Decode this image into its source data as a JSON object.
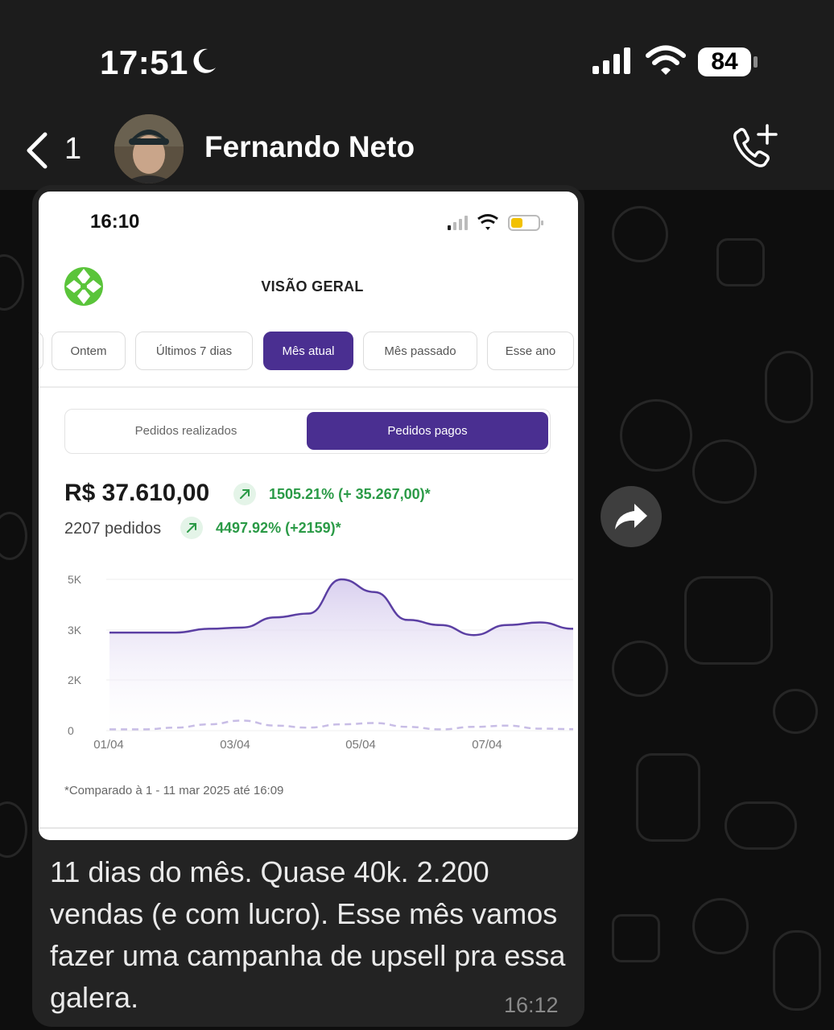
{
  "status_bar": {
    "time": "17:51",
    "battery": "84"
  },
  "header": {
    "back_count": "1",
    "contact_name": "Fernando Neto"
  },
  "message": {
    "text": "11 dias do mês. Quase 40k. 2.200 vendas (e com lucro). Esse mês vamos fazer uma campanha de upsell pra essa galera.",
    "time": "16:12"
  },
  "screenshot": {
    "time": "16:10",
    "title": "VISÃO GERAL",
    "tabs": [
      "Ontem",
      "Últimos 7 dias",
      "Mês atual",
      "Mês passado",
      "Esse ano"
    ],
    "active_tab": "Mês atual",
    "segments": {
      "left": "Pedidos realizados",
      "right": "Pedidos pagos",
      "active": "Pedidos pagos"
    },
    "amount": "R$ 37.610,00",
    "amount_change": "1505.21% (+ 35.267,00)*",
    "orders": "2207 pedidos",
    "orders_change": "4497.92% (+2159)*",
    "footnote": "*Comparado à 1 - 11 mar 2025 até 16:09"
  },
  "chart_data": {
    "type": "area",
    "x_ticks": [
      "01/04",
      "03/04",
      "05/04",
      "07/04"
    ],
    "y_ticks": [
      "5K",
      "3K",
      "2K",
      "0"
    ],
    "series": [
      {
        "values": [
          2950,
          2950,
          2950,
          3050,
          3100,
          3500,
          3650,
          5000,
          4500,
          3400,
          3200,
          2900,
          3200,
          3300,
          3050
        ]
      },
      {
        "values": [
          50,
          50,
          120,
          250,
          400,
          200,
          120,
          250,
          300,
          150,
          50,
          150,
          200,
          80,
          60
        ]
      }
    ],
    "colors": {
      "current": "#5b3fa3",
      "previous": "#c8bde6"
    },
    "grid": true
  },
  "colors": {
    "accent": "#4a2f91",
    "positive": "#2a9a46",
    "bubble": "#232323",
    "header": "#1c1c1c"
  }
}
